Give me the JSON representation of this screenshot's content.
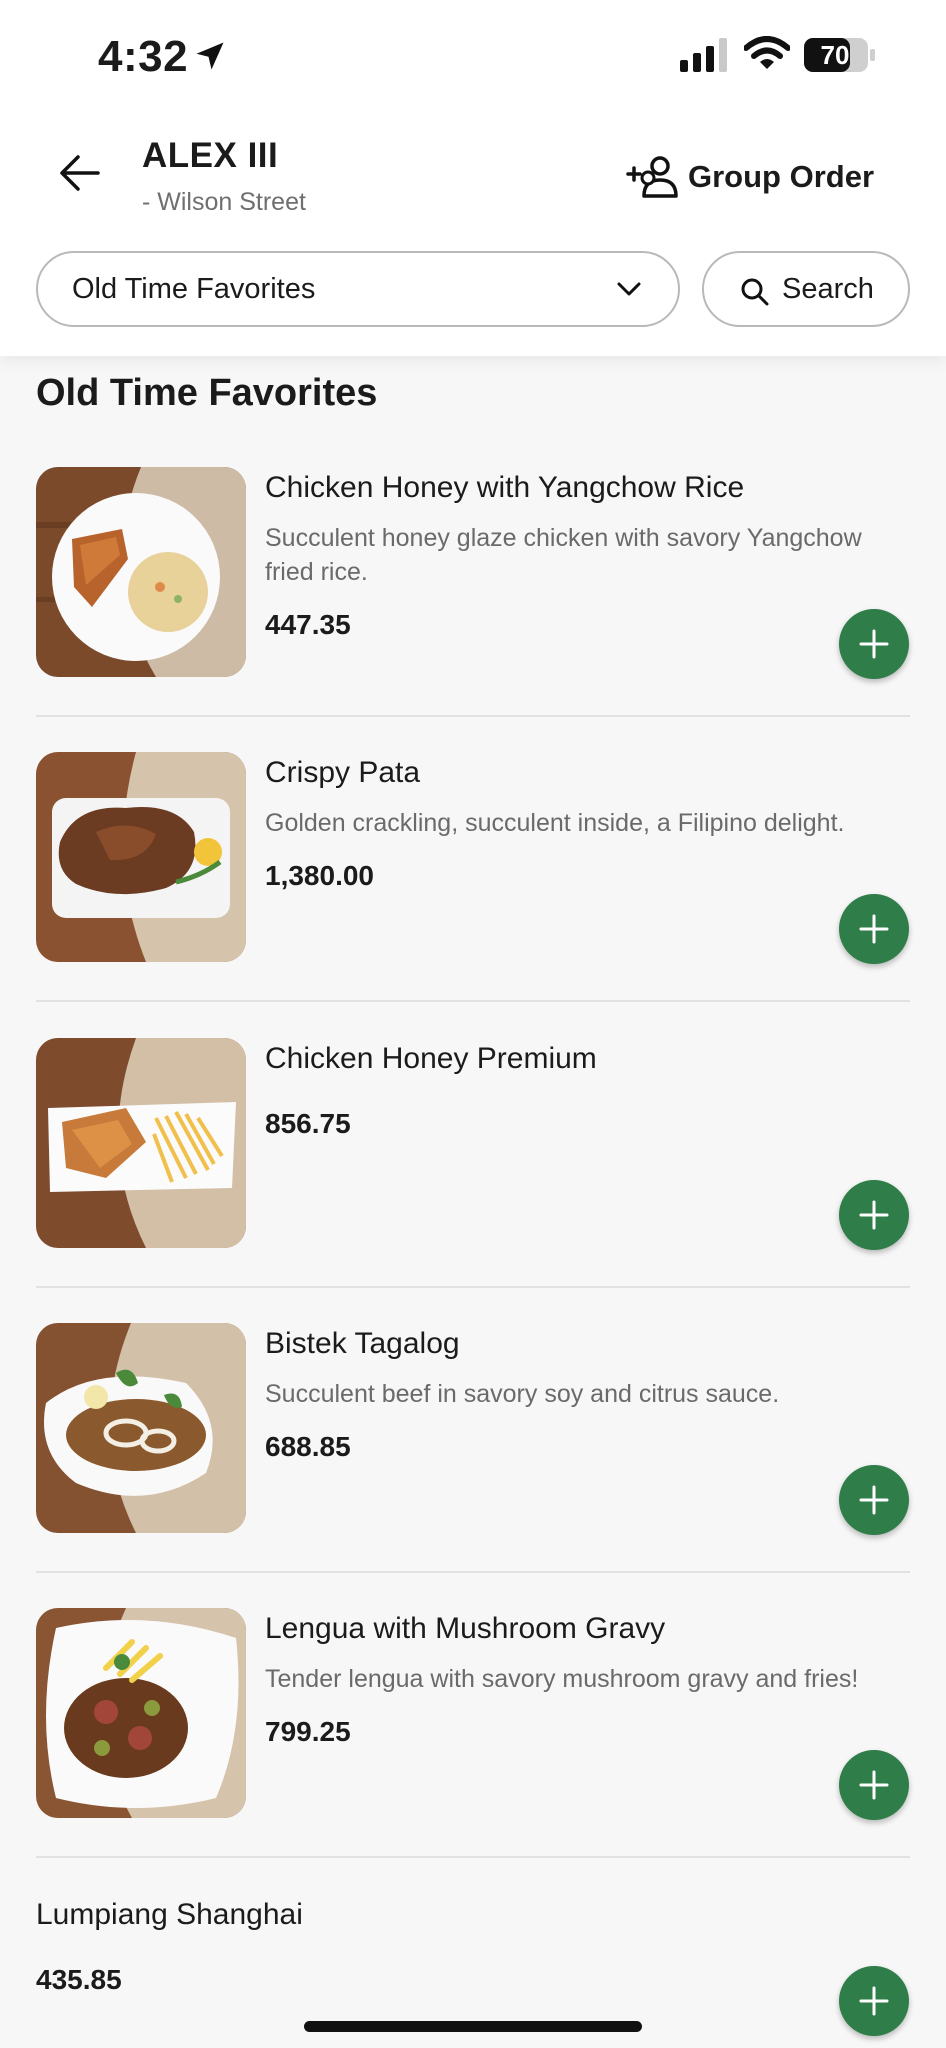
{
  "status": {
    "time": "4:32",
    "battery": "70"
  },
  "header": {
    "store_name": "ALEX III",
    "store_branch": "- Wilson Street",
    "group_order": "Group Order"
  },
  "filters": {
    "category": "Old Time Favorites",
    "search_label": "Search"
  },
  "section_title": "Old Time Favorites",
  "items": [
    {
      "name": "Chicken Honey with Yangchow Rice",
      "desc": "Succulent honey glaze chicken with savory Yangchow fried rice.",
      "price": "447.35"
    },
    {
      "name": "Crispy Pata",
      "desc": "Golden crackling, succulent inside, a Filipino delight.",
      "price": "1,380.00"
    },
    {
      "name": "Chicken Honey Premium",
      "desc": "",
      "price": "856.75"
    },
    {
      "name": "Bistek Tagalog",
      "desc": "Succulent beef in savory soy and citrus sauce.",
      "price": "688.85"
    },
    {
      "name": "Lengua with Mushroom Gravy",
      "desc": "Tender lengua with savory mushroom gravy and fries!",
      "price": "799.25"
    },
    {
      "name": "Lumpiang Shanghai",
      "price": "435.85"
    }
  ],
  "colors": {
    "accent": "#2f7d48",
    "text": "#1b1b1b",
    "muted": "#6a6a6a"
  },
  "icons": [
    "location-arrow-icon",
    "signal-icon",
    "wifi-icon",
    "battery-icon",
    "back-arrow-icon",
    "group-add-icon",
    "chevron-down-icon",
    "search-icon",
    "plus-icon"
  ]
}
